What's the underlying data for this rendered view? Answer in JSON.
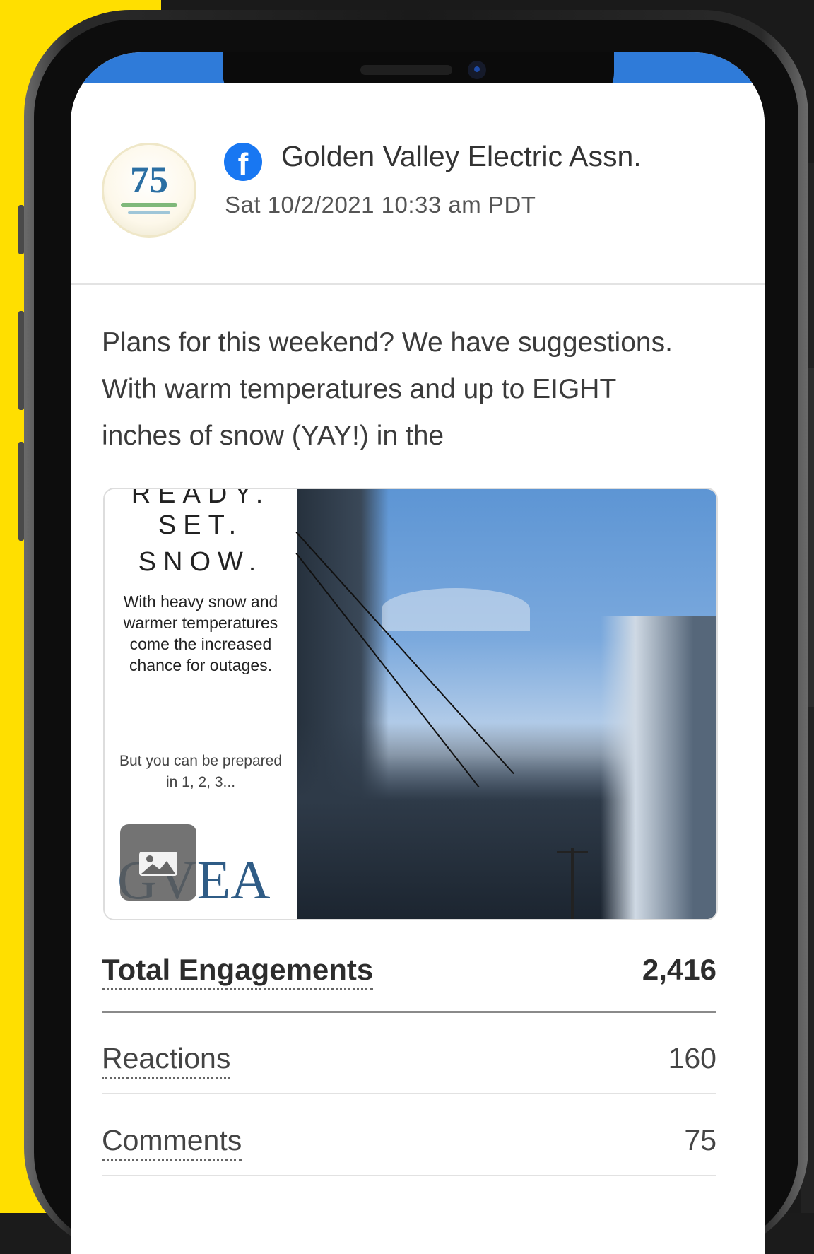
{
  "post": {
    "page_name": "Golden Valley Electric Assn.",
    "timestamp": "Sat 10/2/2021 10:33 am PDT",
    "platform_icon": "facebook-icon",
    "avatar_text": "75",
    "text": "Plans for this weekend? We have suggestions. With warm temperatures and up to EIGHT inches of snow (YAY!) in the",
    "text_faded": ""
  },
  "image": {
    "heading_ready": "READY.",
    "heading_set": "SET.",
    "heading_snow": "SNOW.",
    "description": "With heavy snow and warmer temperatures come the increased chance for outages.",
    "note": "But you can be prepared in 1, 2, 3...",
    "logo_text": "GVEA",
    "badge_icon": "image-icon"
  },
  "metrics": {
    "total_label": "Total Engagements",
    "total_value": "2,416",
    "reactions_label": "Reactions",
    "reactions_value": "160",
    "comments_label": "Comments",
    "comments_value": "75"
  },
  "colors": {
    "accent_yellow": "#ffdf00",
    "facebook_blue": "#1877f2",
    "status_strip": "#2f7bd9"
  }
}
